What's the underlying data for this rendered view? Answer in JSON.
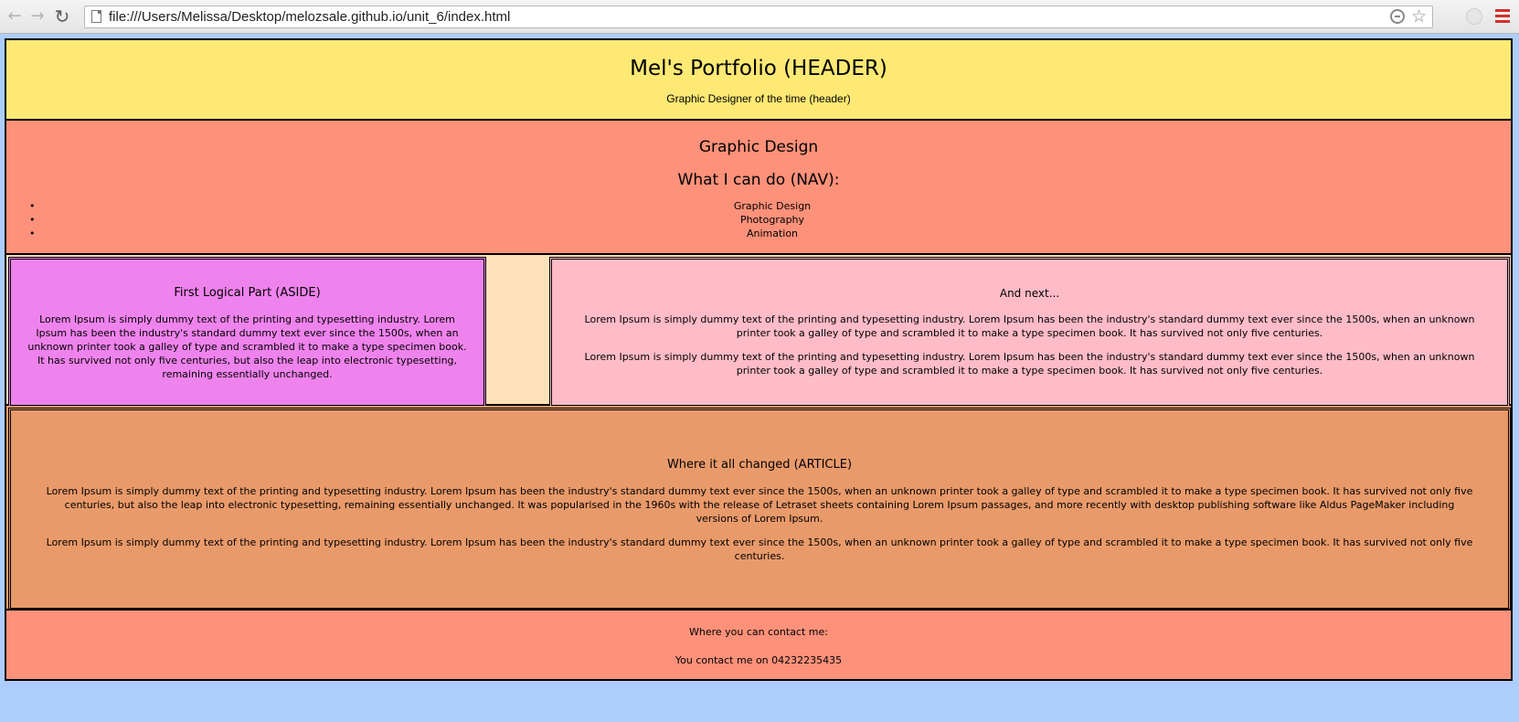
{
  "browser": {
    "url": "file:///Users/Melissa/Desktop/melozsale.github.io/unit_6/index.html",
    "back_icon": "←",
    "forward_icon": "→",
    "reload_icon": "↻",
    "star_icon": "☆"
  },
  "header": {
    "title": "Mel's Portfolio (HEADER)",
    "subtitle": "Graphic Designer of the time (header)"
  },
  "nav": {
    "title": "Graphic Design",
    "subtitle": "What I can do (NAV):",
    "items": [
      {
        "label": "Graphic Design"
      },
      {
        "label": "Photography"
      },
      {
        "label": "Animation"
      }
    ]
  },
  "aside": {
    "title": "First Logical Part (ASIDE)",
    "text": "Lorem Ipsum is simply dummy text of the printing and typesetting industry. Lorem Ipsum has been the industry's standard dummy text ever since the 1500s, when an unknown printer took a galley of type and scrambled it to make a type specimen book. It has survived not only five centuries, but also the leap into electronic typesetting, remaining essentially unchanged."
  },
  "next": {
    "title": "And next...",
    "paragraphs": [
      "Lorem Ipsum is simply dummy text of the printing and typesetting industry. Lorem Ipsum has been the industry's standard dummy text ever since the 1500s, when an unknown printer took a galley of type and scrambled it to make a type specimen book. It has survived not only five centuries.",
      "Lorem Ipsum is simply dummy text of the printing and typesetting industry. Lorem Ipsum has been the industry's standard dummy text ever since the 1500s, when an unknown printer took a galley of type and scrambled it to make a type specimen book. It has survived not only five centuries."
    ]
  },
  "article": {
    "title": "Where it all changed (ARTICLE)",
    "paragraphs": [
      "Lorem Ipsum is simply dummy text of the printing and typesetting industry. Lorem Ipsum has been the industry's standard dummy text ever since the 1500s, when an unknown printer took a galley of type and scrambled it to make a type specimen book. It has survived not only five centuries, but also the leap into electronic typesetting, remaining essentially unchanged. It was popularised in the 1960s with the release of Letraset sheets containing Lorem Ipsum passages, and more recently with desktop publishing software like Aldus PageMaker including versions of Lorem Ipsum.",
      "Lorem Ipsum is simply dummy text of the printing and typesetting industry. Lorem Ipsum has been the industry's standard dummy text ever since the 1500s, when an unknown printer took a galley of type and scrambled it to make a type specimen book. It has survived not only five centuries."
    ]
  },
  "footer": {
    "heading": "Where you can contact me:",
    "phone_text": "You contact me on 04232235435"
  },
  "colors": {
    "page_background": "#adcdfc",
    "header": "#fee974",
    "nav": "#fe917a",
    "middle_gap": "#fee0b9",
    "aside": "#ef83ed",
    "next": "#ffbbc8",
    "article": "#e99a6a",
    "footer": "#fe917a"
  }
}
